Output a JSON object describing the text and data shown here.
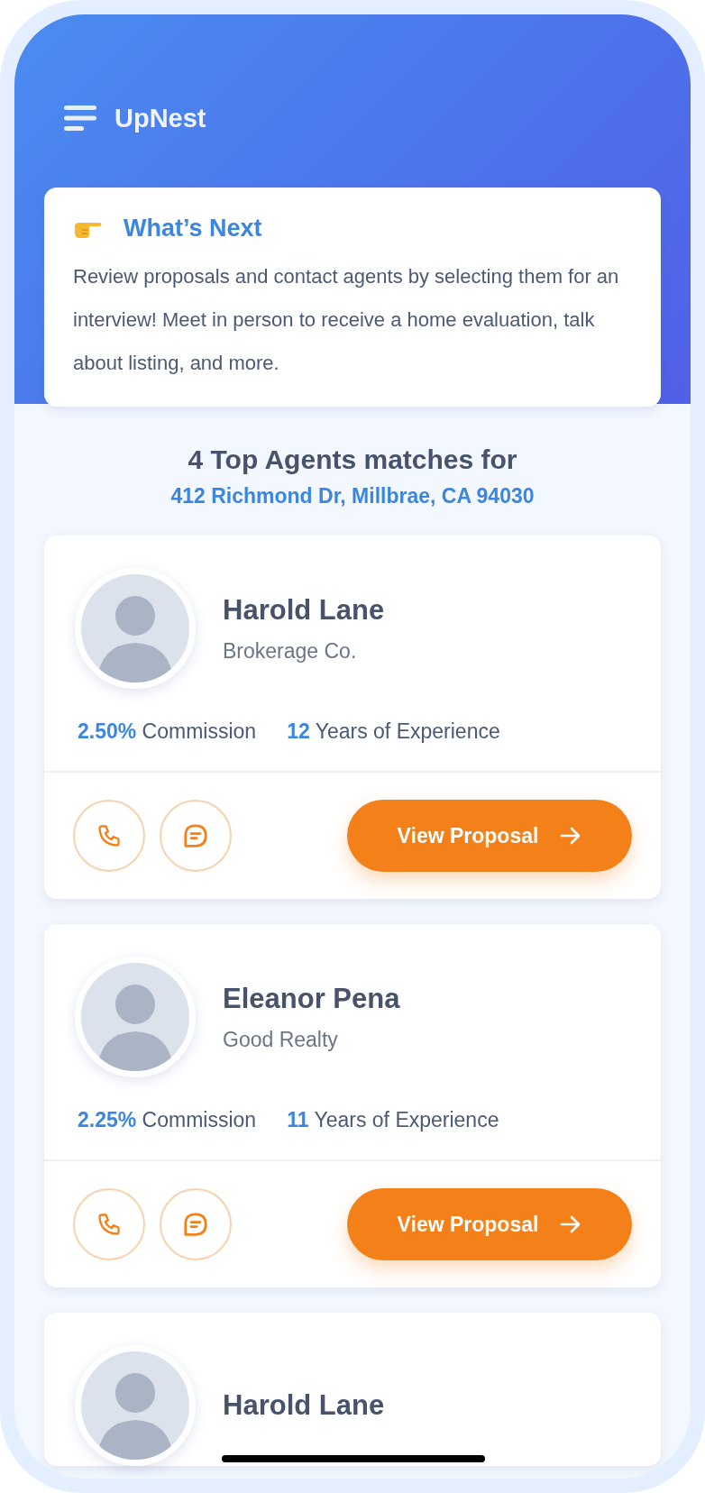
{
  "app": {
    "title": "UpNest"
  },
  "next_card": {
    "title": "What’s Next",
    "text": "Review proposals and contact agents by selecting them for an interview! Meet in person to receive a home evaluation, talk about listing, and more."
  },
  "matches": {
    "heading": "4 Top Agents matches for",
    "address": "412 Richmond Dr, Millbrae, CA 94030"
  },
  "agents": [
    {
      "name": "Harold Lane",
      "company": "Brokerage Co.",
      "commission": "2.50%",
      "commission_label": "Commission",
      "years": "12",
      "years_label": "Years of Experience",
      "button": "View Proposal"
    },
    {
      "name": "Eleanor Pena",
      "company": "Good Realty",
      "commission": "2.25%",
      "commission_label": "Commission",
      "years": "11",
      "years_label": "Years of Experience",
      "button": "View Proposal"
    },
    {
      "name": "Harold Lane"
    }
  ]
}
